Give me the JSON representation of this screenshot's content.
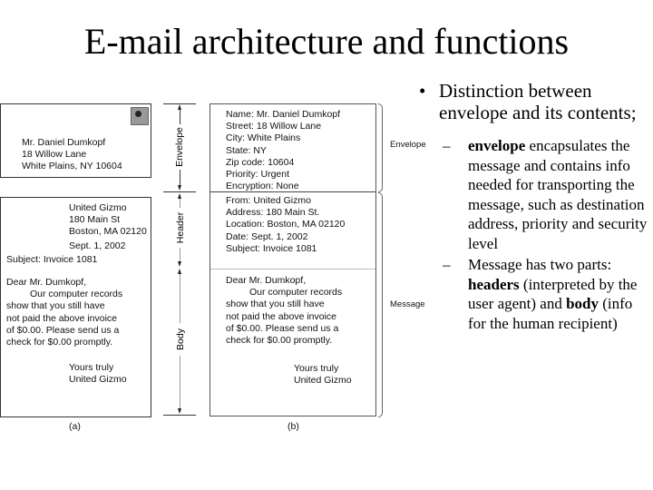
{
  "title": "E-mail architecture and functions",
  "figure": {
    "panel_a": {
      "caption": "(a)",
      "stamp_icon": "postage-stamp-icon",
      "envelope_lines": [
        "Mr. Daniel Dumkopf",
        "18 Willow Lane",
        "White Plains, NY 10604"
      ],
      "letter_header_lines": [
        "United Gizmo",
        "180 Main St",
        "Boston, MA 02120",
        "Sept. 1, 2002"
      ],
      "subject": "Subject: Invoice 1081",
      "salutation": "Dear Mr. Dumkopf,",
      "body_lines": [
        "Our computer records",
        "show that you still have",
        "not paid the above invoice",
        "of $0.00. Please send us a",
        "check for $0.00 promptly."
      ],
      "closing_lines": [
        "Yours truly",
        "United Gizmo"
      ]
    },
    "side_labels": {
      "envelope": "Envelope",
      "header": "Header",
      "body": "Body"
    },
    "panel_b": {
      "caption": "(b)",
      "envelope_fields": [
        "Name: Mr. Daniel Dumkopf",
        "Street: 18 Willow Lane",
        "City: White Plains",
        "State: NY",
        "Zip code: 10604",
        "Priority: Urgent",
        "Encryption: None"
      ],
      "header_fields": [
        "From: United Gizmo",
        "Address: 180 Main St.",
        "Location: Boston, MA 02120",
        "Date: Sept. 1, 2002",
        "Subject: Invoice 1081"
      ],
      "salutation": "Dear Mr. Dumkopf,",
      "body_lines": [
        "Our computer records",
        "show that you still have",
        "not paid the above invoice",
        "of $0.00. Please send us a",
        "check for $0.00 promptly."
      ],
      "closing_lines": [
        "Yours truly",
        "United Gizmo"
      ]
    },
    "brace_labels": {
      "envelope": "Envelope",
      "message": "Message"
    }
  },
  "bullets": {
    "main": "Distinction between envelope and its contents;",
    "sub1": {
      "term": "envelope",
      "text": "encapsulates the message and contains info needed for transporting the message, such as destination address, priority and security level"
    },
    "sub2": {
      "prefix": "Message has two parts: ",
      "term1": "headers",
      "middle": " (interpreted by the user agent) and ",
      "term2": "body",
      "suffix": " (info for the human recipient)"
    }
  }
}
